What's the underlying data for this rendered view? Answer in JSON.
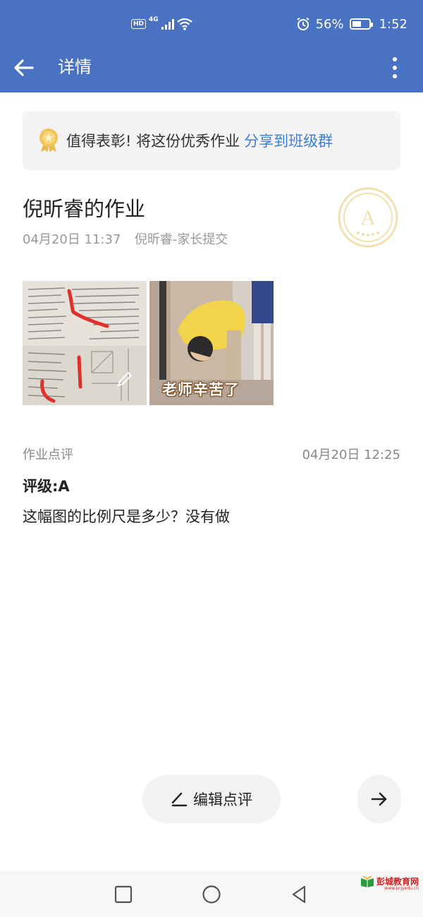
{
  "status_bar": {
    "hd": "HD",
    "network": "4G",
    "battery_percent": "56%",
    "battery_level": 0.56,
    "time": "1:52",
    "icons": [
      "hd-icon",
      "signal-icon",
      "wifi-icon",
      "alarm-icon",
      "battery-icon"
    ]
  },
  "header": {
    "title": "详情",
    "back_icon": "back-arrow-icon",
    "more_icon": "more-vertical-icon",
    "background": "#4a72c2"
  },
  "praise_banner": {
    "text": "值得表彰! 将这份优秀作业",
    "link": "分享到班级群",
    "icon": "medal-icon",
    "link_color": "#3d7fd6"
  },
  "homework": {
    "title": "倪昕睿的作业",
    "date": "04月20日 11:37",
    "submitter": "倪昕睿-家长提交",
    "grade_stamp": "A"
  },
  "thumbnails": [
    {
      "type": "textbook-photo",
      "edit_icon": "pencil-icon"
    },
    {
      "type": "bowing-child-meme",
      "caption": "老师辛苦了"
    }
  ],
  "review": {
    "label": "作业点评",
    "time": "04月20日 12:25",
    "grade": "评级:A",
    "comment": "这幅图的比例尺是多少？没有做"
  },
  "actions": {
    "edit_label": "编辑点评",
    "edit_icon": "edit-pen-icon",
    "next_icon": "arrow-right-icon"
  },
  "nav_bar": {
    "icons": [
      "recent-apps-icon",
      "home-icon",
      "back-triangle-icon"
    ]
  },
  "watermark": {
    "text": "彭城教育网",
    "url": "www.pcjyedu.cn"
  }
}
